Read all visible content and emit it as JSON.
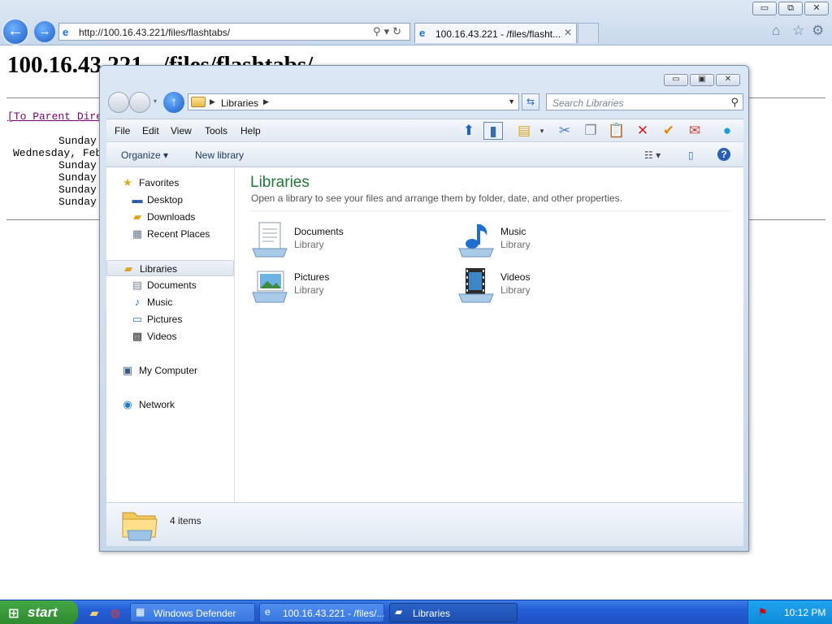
{
  "ie": {
    "url": "http://100.16.43.221/files/flashtabs/",
    "tab_title": "100.16.43.221 - /files/flasht...",
    "tab_close": "✕",
    "caption_minimize": "▭",
    "caption_maximize": "⧉",
    "caption_close": "✕"
  },
  "webpage": {
    "heading": "100.16.43.221 - /files/flashtabs/",
    "parent_link": "[To Parent Directory]",
    "listing": [
      "Sunday",
      "Wednesday, Feb",
      "Sunday",
      "Sunday",
      "Sunday",
      "Sunday"
    ]
  },
  "explorer": {
    "breadcrumb": "Libraries",
    "search_placeholder": "Search Libraries",
    "menu": [
      "File",
      "Edit",
      "View",
      "Tools",
      "Help"
    ],
    "commands": {
      "organize": "Organize ▾",
      "new_library": "New library"
    },
    "nav": {
      "favorites": "Favorites",
      "desktop": "Desktop",
      "downloads": "Downloads",
      "recent_places": "Recent Places",
      "libraries": "Libraries",
      "documents": "Documents",
      "music": "Music",
      "pictures": "Pictures",
      "videos": "Videos",
      "my_computer": "My Computer",
      "network": "Network"
    },
    "content": {
      "title": "Libraries",
      "description": "Open a library to see your files and arrange them by folder, date, and other properties.",
      "items": [
        {
          "name": "Documents",
          "type": "Library",
          "icon": "documents-library-icon"
        },
        {
          "name": "Music",
          "type": "Library",
          "icon": "music-library-icon"
        },
        {
          "name": "Pictures",
          "type": "Library",
          "icon": "pictures-library-icon"
        },
        {
          "name": "Videos",
          "type": "Library",
          "icon": "videos-library-icon"
        }
      ]
    },
    "status": "4 items"
  },
  "taskbar": {
    "start": "start",
    "tasks": [
      {
        "label": "Windows Defender",
        "icon": "windows-defender-icon"
      },
      {
        "label": "100.16.43.221 - /files/...",
        "icon": "internet-explorer-icon"
      },
      {
        "label": "Libraries",
        "icon": "folder-icon"
      }
    ],
    "clock": "10:12 PM"
  },
  "colors": {
    "library_title": "#1e7a3a",
    "taskbar": "#245ed6",
    "start_button": "#2f8a30",
    "visited_link": "#7a0070"
  }
}
